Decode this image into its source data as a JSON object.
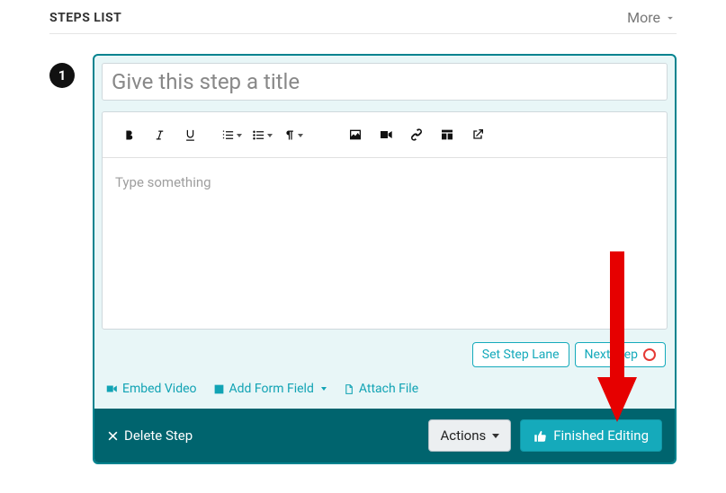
{
  "header": {
    "title": "STEPS LIST",
    "more": "More"
  },
  "step": {
    "number": "1",
    "title_placeholder": "Give this step a title",
    "body_placeholder": "Type something"
  },
  "lane": {
    "set_lane": "Set Step Lane",
    "next_step": "Next step"
  },
  "attach": {
    "embed_video": "Embed Video",
    "add_form_field": "Add Form Field",
    "attach_file": "Attach File"
  },
  "footer": {
    "delete": "Delete Step",
    "actions": "Actions",
    "finished": "Finished Editing"
  }
}
